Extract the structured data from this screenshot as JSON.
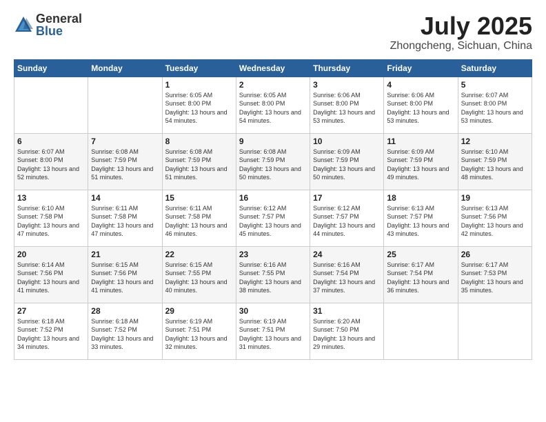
{
  "header": {
    "logo_general": "General",
    "logo_blue": "Blue",
    "month_title": "July 2025",
    "location": "Zhongcheng, Sichuan, China"
  },
  "weekdays": [
    "Sunday",
    "Monday",
    "Tuesday",
    "Wednesday",
    "Thursday",
    "Friday",
    "Saturday"
  ],
  "weeks": [
    [
      {
        "day": "",
        "info": ""
      },
      {
        "day": "",
        "info": ""
      },
      {
        "day": "1",
        "info": "Sunrise: 6:05 AM\nSunset: 8:00 PM\nDaylight: 13 hours and 54 minutes."
      },
      {
        "day": "2",
        "info": "Sunrise: 6:05 AM\nSunset: 8:00 PM\nDaylight: 13 hours and 54 minutes."
      },
      {
        "day": "3",
        "info": "Sunrise: 6:06 AM\nSunset: 8:00 PM\nDaylight: 13 hours and 53 minutes."
      },
      {
        "day": "4",
        "info": "Sunrise: 6:06 AM\nSunset: 8:00 PM\nDaylight: 13 hours and 53 minutes."
      },
      {
        "day": "5",
        "info": "Sunrise: 6:07 AM\nSunset: 8:00 PM\nDaylight: 13 hours and 53 minutes."
      }
    ],
    [
      {
        "day": "6",
        "info": "Sunrise: 6:07 AM\nSunset: 8:00 PM\nDaylight: 13 hours and 52 minutes."
      },
      {
        "day": "7",
        "info": "Sunrise: 6:08 AM\nSunset: 7:59 PM\nDaylight: 13 hours and 51 minutes."
      },
      {
        "day": "8",
        "info": "Sunrise: 6:08 AM\nSunset: 7:59 PM\nDaylight: 13 hours and 51 minutes."
      },
      {
        "day": "9",
        "info": "Sunrise: 6:08 AM\nSunset: 7:59 PM\nDaylight: 13 hours and 50 minutes."
      },
      {
        "day": "10",
        "info": "Sunrise: 6:09 AM\nSunset: 7:59 PM\nDaylight: 13 hours and 50 minutes."
      },
      {
        "day": "11",
        "info": "Sunrise: 6:09 AM\nSunset: 7:59 PM\nDaylight: 13 hours and 49 minutes."
      },
      {
        "day": "12",
        "info": "Sunrise: 6:10 AM\nSunset: 7:59 PM\nDaylight: 13 hours and 48 minutes."
      }
    ],
    [
      {
        "day": "13",
        "info": "Sunrise: 6:10 AM\nSunset: 7:58 PM\nDaylight: 13 hours and 47 minutes."
      },
      {
        "day": "14",
        "info": "Sunrise: 6:11 AM\nSunset: 7:58 PM\nDaylight: 13 hours and 47 minutes."
      },
      {
        "day": "15",
        "info": "Sunrise: 6:11 AM\nSunset: 7:58 PM\nDaylight: 13 hours and 46 minutes."
      },
      {
        "day": "16",
        "info": "Sunrise: 6:12 AM\nSunset: 7:57 PM\nDaylight: 13 hours and 45 minutes."
      },
      {
        "day": "17",
        "info": "Sunrise: 6:12 AM\nSunset: 7:57 PM\nDaylight: 13 hours and 44 minutes."
      },
      {
        "day": "18",
        "info": "Sunrise: 6:13 AM\nSunset: 7:57 PM\nDaylight: 13 hours and 43 minutes."
      },
      {
        "day": "19",
        "info": "Sunrise: 6:13 AM\nSunset: 7:56 PM\nDaylight: 13 hours and 42 minutes."
      }
    ],
    [
      {
        "day": "20",
        "info": "Sunrise: 6:14 AM\nSunset: 7:56 PM\nDaylight: 13 hours and 41 minutes."
      },
      {
        "day": "21",
        "info": "Sunrise: 6:15 AM\nSunset: 7:56 PM\nDaylight: 13 hours and 41 minutes."
      },
      {
        "day": "22",
        "info": "Sunrise: 6:15 AM\nSunset: 7:55 PM\nDaylight: 13 hours and 40 minutes."
      },
      {
        "day": "23",
        "info": "Sunrise: 6:16 AM\nSunset: 7:55 PM\nDaylight: 13 hours and 38 minutes."
      },
      {
        "day": "24",
        "info": "Sunrise: 6:16 AM\nSunset: 7:54 PM\nDaylight: 13 hours and 37 minutes."
      },
      {
        "day": "25",
        "info": "Sunrise: 6:17 AM\nSunset: 7:54 PM\nDaylight: 13 hours and 36 minutes."
      },
      {
        "day": "26",
        "info": "Sunrise: 6:17 AM\nSunset: 7:53 PM\nDaylight: 13 hours and 35 minutes."
      }
    ],
    [
      {
        "day": "27",
        "info": "Sunrise: 6:18 AM\nSunset: 7:52 PM\nDaylight: 13 hours and 34 minutes."
      },
      {
        "day": "28",
        "info": "Sunrise: 6:18 AM\nSunset: 7:52 PM\nDaylight: 13 hours and 33 minutes."
      },
      {
        "day": "29",
        "info": "Sunrise: 6:19 AM\nSunset: 7:51 PM\nDaylight: 13 hours and 32 minutes."
      },
      {
        "day": "30",
        "info": "Sunrise: 6:19 AM\nSunset: 7:51 PM\nDaylight: 13 hours and 31 minutes."
      },
      {
        "day": "31",
        "info": "Sunrise: 6:20 AM\nSunset: 7:50 PM\nDaylight: 13 hours and 29 minutes."
      },
      {
        "day": "",
        "info": ""
      },
      {
        "day": "",
        "info": ""
      }
    ]
  ]
}
